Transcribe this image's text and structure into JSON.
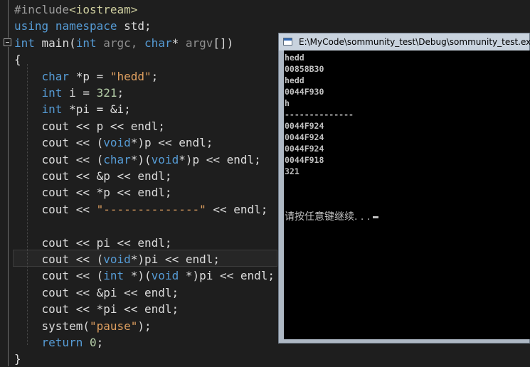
{
  "editor": {
    "lines": [
      {
        "tokens": [
          [
            "pp",
            "#include"
          ],
          [
            "inc",
            "<iostream>"
          ]
        ]
      },
      {
        "tokens": [
          [
            "kw",
            "using"
          ],
          [
            "id",
            " "
          ],
          [
            "kw",
            "namespace"
          ],
          [
            "id",
            " std;"
          ]
        ]
      },
      {
        "tokens": [
          [
            "kw",
            "int"
          ],
          [
            "id",
            " main("
          ],
          [
            "kw",
            "int"
          ],
          [
            "par",
            " argc, "
          ],
          [
            "kw",
            "char"
          ],
          [
            "id",
            "* "
          ],
          [
            "par",
            "argv"
          ],
          [
            "id",
            "[])"
          ]
        ]
      },
      {
        "tokens": [
          [
            "id",
            "{"
          ]
        ]
      },
      {
        "tokens": [
          [
            "id",
            "    "
          ],
          [
            "kw",
            "char"
          ],
          [
            "id",
            " *p = "
          ],
          [
            "str",
            "\"hedd\""
          ],
          [
            "id",
            ";"
          ]
        ]
      },
      {
        "tokens": [
          [
            "id",
            "    "
          ],
          [
            "kw",
            "int"
          ],
          [
            "id",
            " i = "
          ],
          [
            "num",
            "321"
          ],
          [
            "id",
            ";"
          ]
        ]
      },
      {
        "tokens": [
          [
            "id",
            "    "
          ],
          [
            "kw",
            "int"
          ],
          [
            "id",
            " *pi = &i;"
          ]
        ]
      },
      {
        "tokens": [
          [
            "id",
            "    cout << p << endl;"
          ]
        ]
      },
      {
        "tokens": [
          [
            "id",
            "    cout << ("
          ],
          [
            "kw",
            "void"
          ],
          [
            "id",
            "*)p << endl;"
          ]
        ]
      },
      {
        "tokens": [
          [
            "id",
            "    cout << ("
          ],
          [
            "kw",
            "char"
          ],
          [
            "id",
            "*)("
          ],
          [
            "kw",
            "void"
          ],
          [
            "id",
            "*)p << endl;"
          ]
        ]
      },
      {
        "tokens": [
          [
            "id",
            "    cout << &p << endl;"
          ]
        ]
      },
      {
        "tokens": [
          [
            "id",
            "    cout << *p << endl;"
          ]
        ]
      },
      {
        "tokens": [
          [
            "id",
            "    cout << "
          ],
          [
            "str",
            "\"--------------\""
          ],
          [
            "id",
            " << endl;"
          ]
        ]
      },
      {
        "tokens": [
          [
            "id",
            ""
          ]
        ]
      },
      {
        "tokens": [
          [
            "id",
            "    cout << pi << endl;"
          ]
        ]
      },
      {
        "tokens": [
          [
            "id",
            "    cout << ("
          ],
          [
            "kw",
            "void"
          ],
          [
            "id",
            "*)pi << endl;"
          ]
        ]
      },
      {
        "tokens": [
          [
            "id",
            "    cout << ("
          ],
          [
            "kw",
            "int"
          ],
          [
            "id",
            " *)("
          ],
          [
            "kw",
            "void"
          ],
          [
            "id",
            " *)pi << endl;"
          ]
        ]
      },
      {
        "tokens": [
          [
            "id",
            "    cout << &pi << endl;"
          ]
        ]
      },
      {
        "tokens": [
          [
            "id",
            "    cout << *pi << endl;"
          ]
        ]
      },
      {
        "tokens": [
          [
            "id",
            "    system("
          ],
          [
            "str",
            "\"pause\""
          ],
          [
            "id",
            ");"
          ]
        ]
      },
      {
        "tokens": [
          [
            "id",
            "    "
          ],
          [
            "kw",
            "return"
          ],
          [
            "id",
            " "
          ],
          [
            "num",
            "0"
          ],
          [
            "id",
            ";"
          ]
        ]
      },
      {
        "tokens": [
          [
            "id",
            "}"
          ]
        ]
      }
    ]
  },
  "console": {
    "title": "E:\\MyCode\\sommunity_test\\Debug\\sommunity_test.exe",
    "output": [
      "hedd",
      "00858B30",
      "hedd",
      "0044F930",
      "h",
      "--------------",
      "0044F924",
      "0044F924",
      "0044F924",
      "0044F918",
      "321"
    ],
    "prompt": "请按任意键继续. . ."
  }
}
